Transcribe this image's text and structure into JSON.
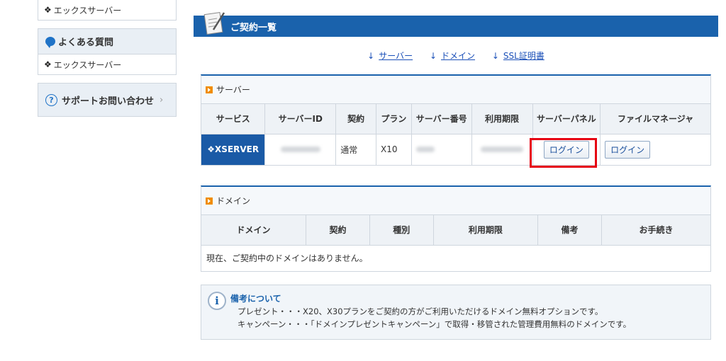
{
  "sidebar": {
    "top_link": "エックスサーバー",
    "faq": {
      "title": "よくある質問",
      "link": "エックスサーバー"
    },
    "support": {
      "label": "サポートお問い合わせ",
      "chevron": "›"
    }
  },
  "main": {
    "title": "ご契約一覧",
    "anchors": [
      {
        "arrow": "↓",
        "label": "サーバー"
      },
      {
        "arrow": "↓",
        "label": "ドメイン"
      },
      {
        "arrow": "↓",
        "label": "SSL証明書"
      }
    ],
    "server_panel": {
      "title": "サーバー",
      "headers": [
        "サービス",
        "サーバーID",
        "契約",
        "プラン",
        "サーバー番号",
        "利用期限",
        "サーバーパネル",
        "ファイルマネージャ"
      ],
      "row": {
        "service": "XSERVER",
        "contract": "通常",
        "plan": "X10",
        "panel_login": "ログイン",
        "file_login": "ログイン"
      }
    },
    "domain_panel": {
      "title": "ドメイン",
      "headers": [
        "ドメイン",
        "契約",
        "種別",
        "利用期限",
        "備考",
        "お手続き"
      ],
      "empty_message": "現在、ご契約中のドメインはありません。"
    },
    "note": {
      "title": "備考について",
      "lines": [
        "プレゼント・・・X20、X30プランをご契約の方がご利用いただけるドメイン無料オプションです。",
        "キャンペーン・・・「ドメインプレゼントキャンペーン」で取得・移管された管理費用無料のドメインです。"
      ]
    }
  },
  "colors": {
    "brand": "#1a62ac",
    "highlight": "#e60012",
    "accent": "#f08c00"
  }
}
